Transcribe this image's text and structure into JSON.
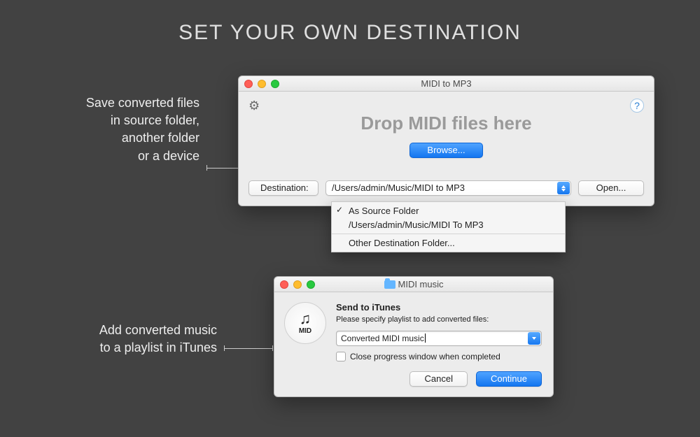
{
  "heading": "SET YOUR OWN DESTINATION",
  "callout1": {
    "line1": "Save converted files",
    "line2": "in source folder,",
    "line3": "another folder",
    "line4": "or a device"
  },
  "callout2": {
    "line1": "Add converted music",
    "line2": "to a playlist in iTunes"
  },
  "window": {
    "title": "MIDI to MP3",
    "drop_title": "Drop MIDI files here",
    "browse": "Browse...",
    "destination_label": "Destination:",
    "destination_value": "/Users/admin/Music/MIDI to MP3",
    "open": "Open..."
  },
  "menu": {
    "item1": "As Source Folder",
    "item2": "/Users/admin/Music/MIDI To MP3",
    "item3": "Other Destination Folder..."
  },
  "dialog": {
    "title": "MIDI music",
    "heading": "Send to iTunes",
    "desc": "Please specify playlist to add converted files:",
    "value": "Converted MIDI music",
    "checkbox": "Close progress window when completed",
    "cancel": "Cancel",
    "continue": "Continue"
  }
}
